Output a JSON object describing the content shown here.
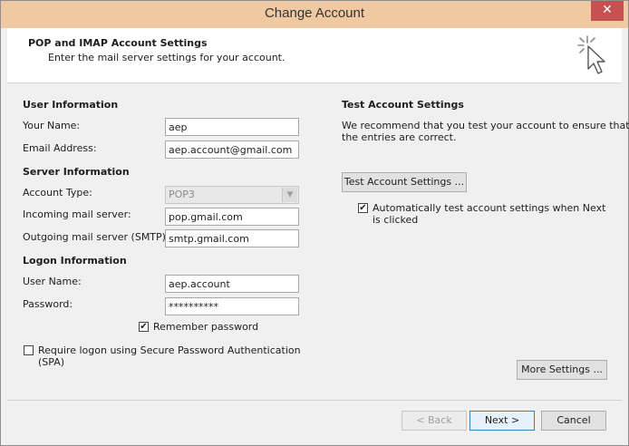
{
  "window": {
    "title": "Change Account",
    "close_glyph": "✕"
  },
  "header": {
    "title": "POP and IMAP Account Settings",
    "subtitle": "Enter the mail server settings for your account."
  },
  "user_info": {
    "heading": "User Information",
    "your_name_label": "Your Name:",
    "your_name_value": "aep",
    "email_label": "Email Address:",
    "email_value": "aep.account@gmail.com"
  },
  "server_info": {
    "heading": "Server Information",
    "account_type_label": "Account Type:",
    "account_type_value": "POP3",
    "incoming_label": "Incoming mail server:",
    "incoming_value": "pop.gmail.com",
    "outgoing_label": "Outgoing mail server (SMTP):",
    "outgoing_value": "smtp.gmail.com"
  },
  "logon_info": {
    "heading": "Logon Information",
    "username_label": "User Name:",
    "username_value": "aep.account",
    "password_label": "Password:",
    "password_value": "**********",
    "remember_label": "Remember password",
    "remember_checked": true,
    "spa_label_line1": "Require logon using Secure Password Authentication",
    "spa_label_line2": "(SPA)",
    "spa_checked": false
  },
  "test_settings": {
    "heading": "Test Account Settings",
    "description_line1": "We recommend that you test your account to ensure that",
    "description_line2": "the entries are correct.",
    "test_button_label": "Test Account Settings ...",
    "auto_test_label_line1": "Automatically test account settings when Next",
    "auto_test_label_line2": "is clicked",
    "auto_test_checked": true
  },
  "buttons": {
    "more_settings": "More Settings ...",
    "back": "< Back",
    "next": "Next >",
    "cancel": "Cancel"
  },
  "colors": {
    "titlebar": "#f0c8a1",
    "close_button": "#c75050",
    "primary_button_border": "#3c7fb1"
  },
  "icons": {
    "header_icon": "cursor-click-icon"
  }
}
